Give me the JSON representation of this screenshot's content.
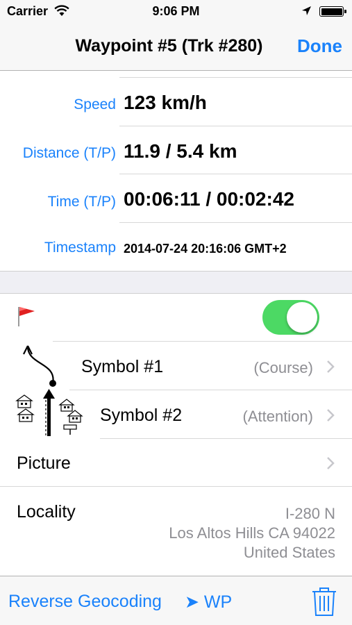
{
  "status_bar": {
    "carrier": "Carrier",
    "time": "9:06 PM"
  },
  "nav": {
    "title": "Waypoint #5 (Trk #280)",
    "done_label": "Done"
  },
  "info": {
    "speed": {
      "label": "Speed",
      "value": "123 km/h"
    },
    "distance": {
      "label": "Distance (T/P)",
      "value": "11.9 / 5.4 km"
    },
    "time": {
      "label": "Time (T/P)",
      "value": "00:06:11 / 00:02:42"
    },
    "timestamp": {
      "label": "Timestamp",
      "value": "2014-07-24 20:16:06 GMT+2"
    }
  },
  "flag_toggle": {
    "on": true,
    "color": "#4cd964"
  },
  "symbols": [
    {
      "label": "Symbol #1",
      "detail": "(Course)"
    },
    {
      "label": "Symbol #2",
      "detail": "(Attention)"
    }
  ],
  "picture": {
    "label": "Picture"
  },
  "locality": {
    "label": "Locality",
    "lines": [
      "I-280 N",
      "Los Altos Hills CA 94022",
      "United States"
    ]
  },
  "toolbar": {
    "reverse_geocoding": "Reverse Geocoding",
    "wp": "➤ WP"
  },
  "colors": {
    "accent": "#1a82fb",
    "toggle_on": "#4cd964"
  }
}
